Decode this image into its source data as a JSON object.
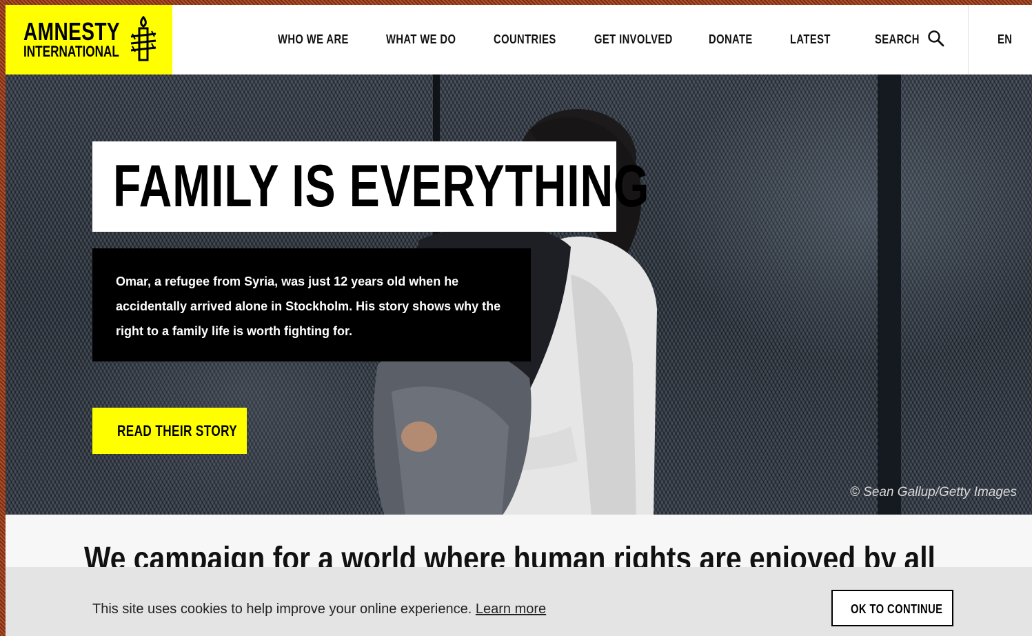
{
  "brand": {
    "line1": "AMNESTY",
    "line2": "INTERNATIONAL",
    "logo_icon": "candle-barbed-wire-icon",
    "accent_color": "#ffff00"
  },
  "nav": {
    "items": [
      {
        "label": "WHO WE ARE"
      },
      {
        "label": "WHAT WE DO"
      },
      {
        "label": "COUNTRIES"
      },
      {
        "label": "GET INVOLVED"
      },
      {
        "label": "DONATE"
      },
      {
        "label": "LATEST"
      }
    ],
    "search_label": "SEARCH",
    "search_icon": "search-icon",
    "language": "EN"
  },
  "hero": {
    "title": "FAMILY IS EVERYTHING",
    "description": "Omar, a refugee from Syria, was just 12 years old when he accidentally arrived alone in Stockholm. His story shows why the right to a family life is worth fighting for.",
    "cta_label": "READ THEIR STORY",
    "photo_credit": "© Sean Gallup/Getty Images"
  },
  "campaign": {
    "heading": "We campaign for a world where human rights are enjoyed by all"
  },
  "cookie_bar": {
    "message": "This site uses cookies to help improve your online experience.",
    "link_label": "Learn more",
    "button_label": "OK TO CONTINUE"
  }
}
